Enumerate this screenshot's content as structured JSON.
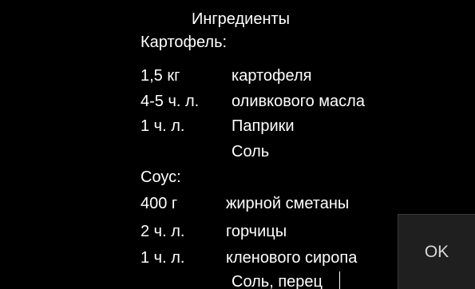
{
  "title": "Ингредиенты",
  "sections": [
    {
      "label": "Картофель:",
      "items": [
        {
          "qty": "1,5 кг",
          "name": "картофеля"
        },
        {
          "qty": "4-5 ч. л.",
          "name": "оливкового масла"
        },
        {
          "qty": "1 ч. л.",
          "name": "Паприки"
        },
        {
          "qty": "",
          "name": "Соль"
        }
      ]
    },
    {
      "label": "Соус:",
      "items": [
        {
          "qty": "400 г",
          "name": "жирной сметаны"
        },
        {
          "qty": "2 ч. л.",
          "name": "горчицы"
        },
        {
          "qty": "1 ч. л.",
          "name": "кленового сиропа"
        },
        {
          "qty": "",
          "name": "Соль, перец"
        }
      ]
    }
  ],
  "ok_button": {
    "label": "OK"
  },
  "colors": {
    "background": "#000000",
    "text": "#ffffff",
    "button_background": "#1f1f1f",
    "button_text": "#d8d8d8"
  }
}
